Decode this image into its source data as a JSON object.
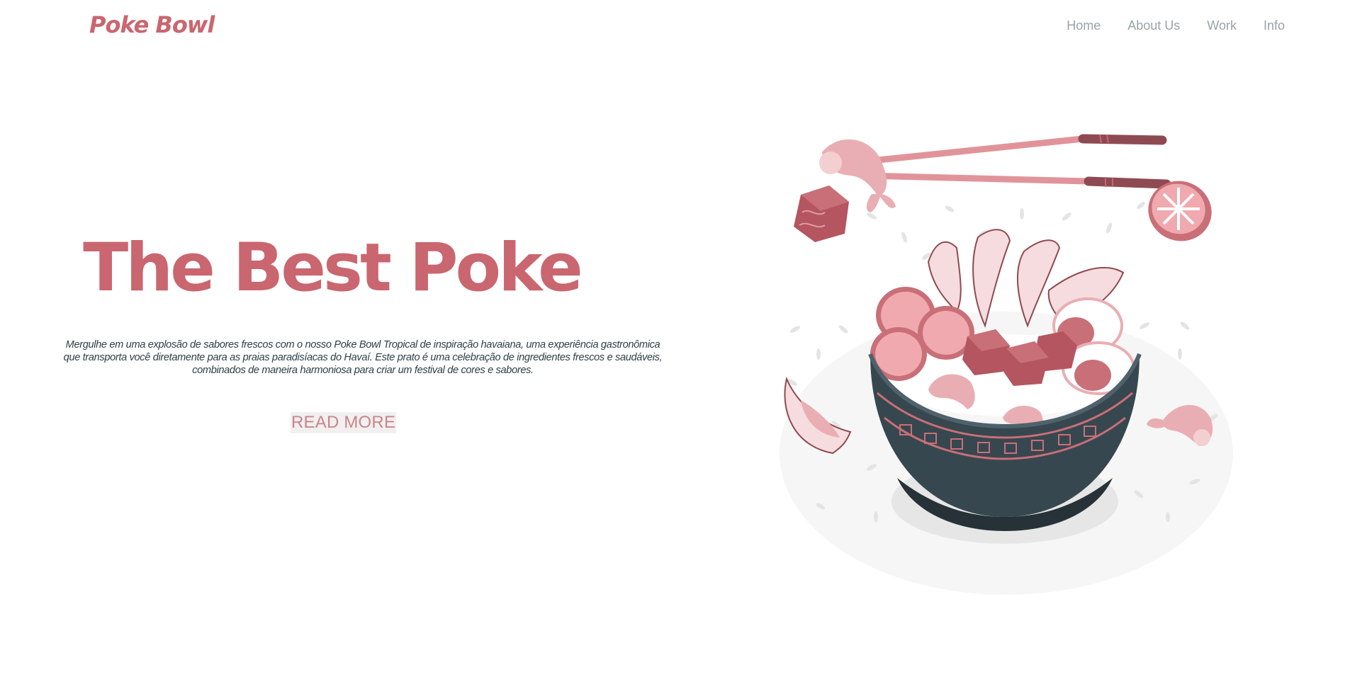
{
  "header": {
    "brand": "Poke Bowl",
    "nav": [
      "Home",
      "About Us",
      "Work",
      "Info"
    ]
  },
  "hero": {
    "title": "The Best Poke",
    "description": "Mergulhe em uma explosão de sabores frescos com o nosso Poke Bowl Tropical de inspiração havaiana, uma experiência gastronômica que transporta você diretamente para as praias paradisíacas do Havaí. Este prato é uma celebração de ingredientes frescos e saudáveis, combinados de maneira harmoniosa para criar um festival de cores e sabores.",
    "cta": "READ MORE"
  },
  "colors": {
    "accent": "#c9666f",
    "nav_text": "#9aa3a8",
    "body_text": "#2e3f48",
    "bowl": "#37474f"
  },
  "illustration": {
    "icon": "poke-bowl-illustration"
  }
}
